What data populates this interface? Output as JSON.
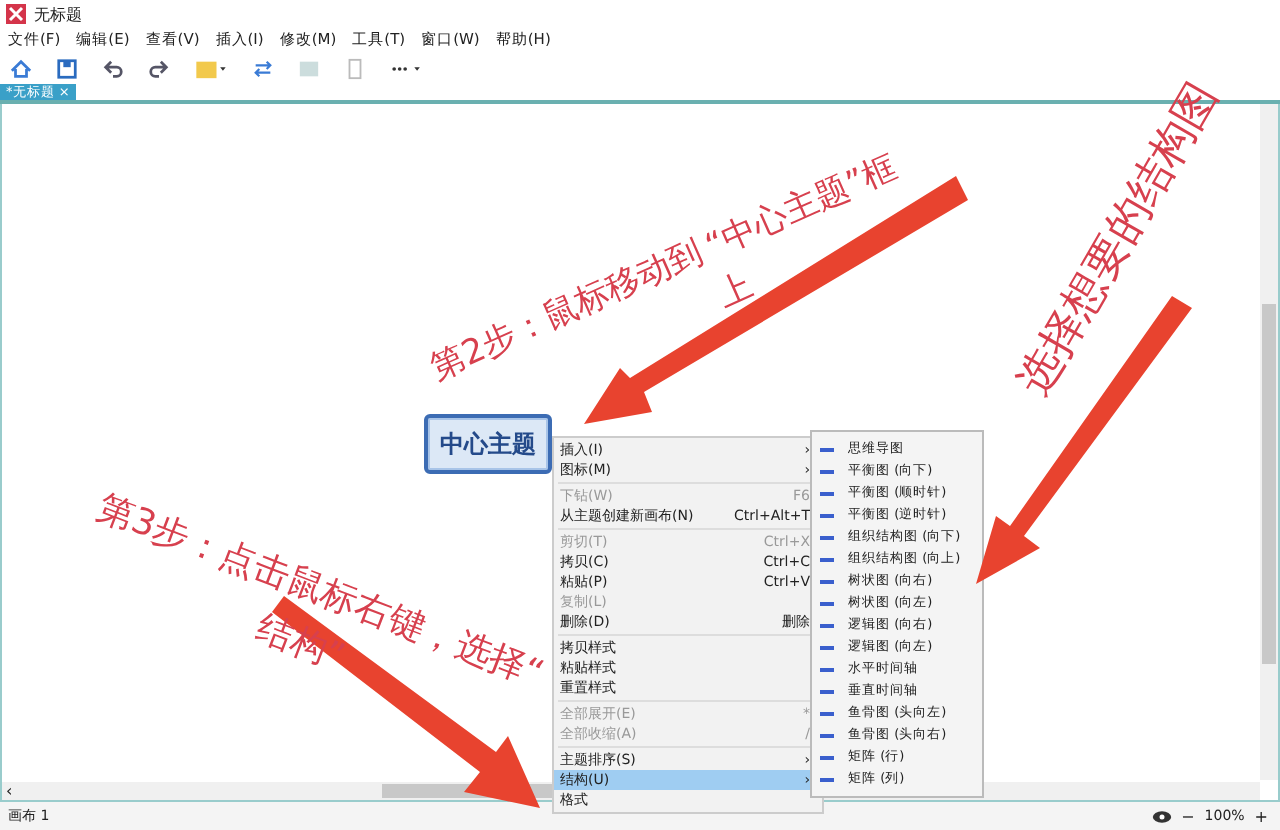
{
  "window": {
    "title": "无标题"
  },
  "menu_bar": [
    "文件(F)",
    "编辑(E)",
    "查看(V)",
    "插入(I)",
    "修改(M)",
    "工具(T)",
    "窗口(W)",
    "帮助(H)"
  ],
  "tab": {
    "label": "*无标题",
    "close": "×",
    "selected": true
  },
  "central_topic": "中心主题",
  "context_menu": [
    {
      "kind": "item",
      "label": "插入(I)",
      "submenu": "›",
      "disabled": false,
      "selected": false
    },
    {
      "kind": "item",
      "label": "图标(M)",
      "submenu": "›",
      "disabled": false,
      "selected": false
    },
    {
      "kind": "separator"
    },
    {
      "kind": "item",
      "label": "下钻(W)",
      "shortcut": "F6",
      "disabled": true,
      "selected": false
    },
    {
      "kind": "item",
      "label": "从主题创建新画布(N)",
      "shortcut": "Ctrl+Alt+T",
      "disabled": false,
      "selected": false
    },
    {
      "kind": "separator"
    },
    {
      "kind": "item",
      "label": "剪切(T)",
      "shortcut": "Ctrl+X",
      "disabled": true,
      "selected": false
    },
    {
      "kind": "item",
      "label": "拷贝(C)",
      "shortcut": "Ctrl+C",
      "disabled": false,
      "selected": false
    },
    {
      "kind": "item",
      "label": "粘贴(P)",
      "shortcut": "Ctrl+V",
      "disabled": false,
      "selected": false
    },
    {
      "kind": "item",
      "label": "复制(L)",
      "disabled": true,
      "selected": false
    },
    {
      "kind": "item",
      "label": "删除(D)",
      "shortcut": "删除",
      "disabled": false,
      "selected": false
    },
    {
      "kind": "separator"
    },
    {
      "kind": "item",
      "label": "拷贝样式",
      "disabled": false,
      "selected": false
    },
    {
      "kind": "item",
      "label": "粘贴样式",
      "disabled": false,
      "selected": false
    },
    {
      "kind": "item",
      "label": "重置样式",
      "disabled": false,
      "selected": false
    },
    {
      "kind": "separator"
    },
    {
      "kind": "item",
      "label": "全部展开(E)",
      "shortcut": "*",
      "disabled": true,
      "selected": false
    },
    {
      "kind": "item",
      "label": "全部收缩(A)",
      "shortcut": "/",
      "disabled": true,
      "selected": false
    },
    {
      "kind": "separator"
    },
    {
      "kind": "item",
      "label": "主题排序(S)",
      "submenu": "›",
      "disabled": false,
      "selected": false
    },
    {
      "kind": "item",
      "label": "结构(U)",
      "submenu": "›",
      "disabled": false,
      "selected": true
    },
    {
      "kind": "item",
      "label": "格式",
      "disabled": false,
      "selected": false
    }
  ],
  "structure_submenu": [
    "思维导图",
    "平衡图 (向下)",
    "平衡图 (顺时针)",
    "平衡图 (逆时针)",
    "组织结构图 (向下)",
    "组织结构图 (向上)",
    "树状图 (向右)",
    "树状图 (向左)",
    "逻辑图 (向右)",
    "逻辑图 (向左)",
    "水平时间轴",
    "垂直时间轴",
    "鱼骨图 (头向左)",
    "鱼骨图 (头向右)",
    "矩阵 (行)",
    "矩阵 (列)"
  ],
  "annotations": [
    {
      "text": "第2步："
    },
    {
      "text": "鼠标移动到"
    },
    {
      "text": "“中心主题”框"
    },
    {
      "text": "上"
    },
    {
      "text": "第3步：点击鼠标右键，选择“"
    },
    {
      "text": "结构”"
    },
    {
      "text": "选择想要的结构图"
    }
  ],
  "scroll_left": "‹",
  "status_bar": {
    "canvas": "画布 1",
    "zoom_out": "−",
    "zoom": "100%",
    "zoom_in": "+"
  }
}
